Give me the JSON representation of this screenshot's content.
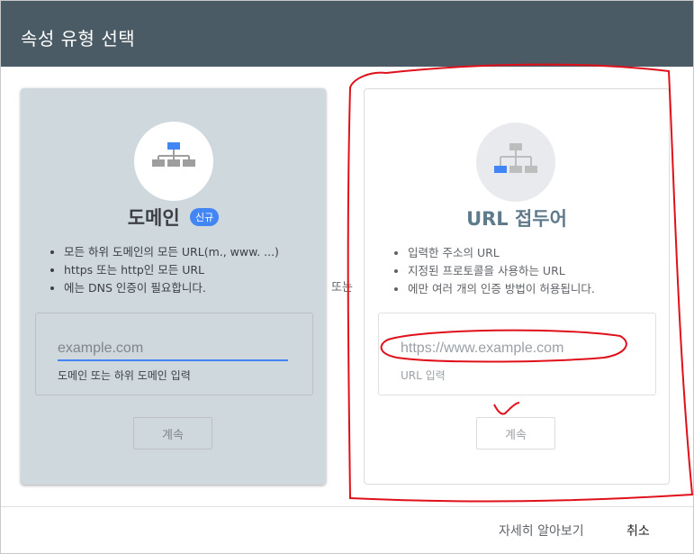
{
  "dialog": {
    "title": "속성 유형 선택"
  },
  "domain_card": {
    "icon": "sitemap-icon",
    "title": "도메인",
    "badge": "신규",
    "bullets": [
      "모든 하위 도메인의 모든 URL(m., www. ...)",
      "https 또는 http인 모든 URL",
      "에는 DNS 인증이 필요합니다."
    ],
    "input_placeholder": "example.com",
    "input_hint": "도메인 또는 하위 도메인 입력",
    "continue_label": "계속"
  },
  "or_label": "또는",
  "url_card": {
    "icon": "sitemap-icon",
    "title": "URL 접두어",
    "bullets": [
      "입력한 주소의 URL",
      "지정된 프로토콜을 사용하는 URL",
      "에만 여러 개의 인증 방법이 허용됩니다."
    ],
    "input_placeholder": "https://www.example.com",
    "input_hint": "URL 입력",
    "continue_label": "계속"
  },
  "footer": {
    "learn_more": "자세히 알아보기",
    "cancel": "취소"
  },
  "colors": {
    "header_bg": "#4b5b66",
    "domain_card_bg": "#cfd8dc",
    "accent_blue": "#4285f4",
    "annotation_red": "#e0101a"
  }
}
